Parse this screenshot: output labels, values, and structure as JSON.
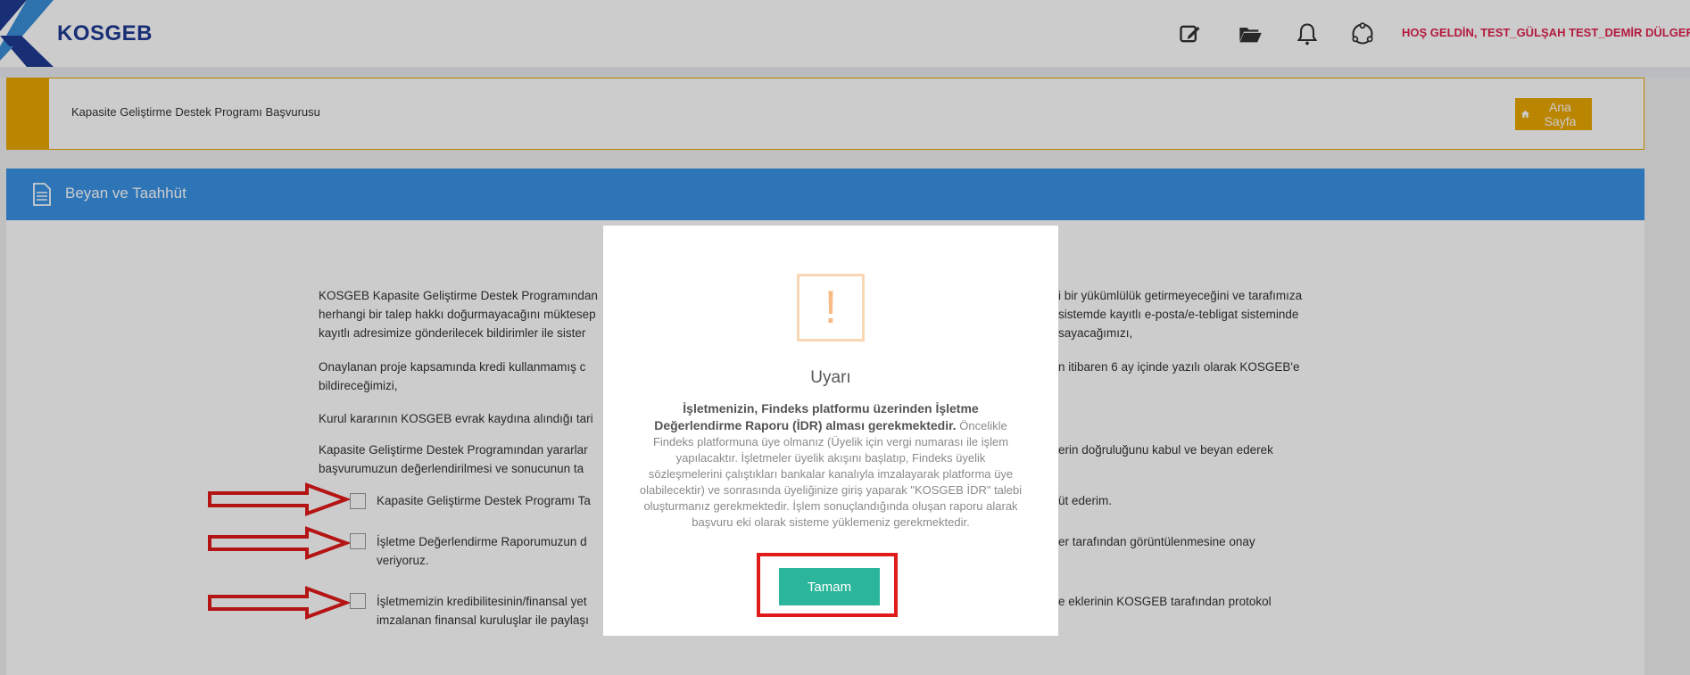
{
  "header": {
    "logo_text": "KOSGEB",
    "icons": [
      "edit-icon",
      "folder-icon",
      "bell-icon",
      "user-icon"
    ],
    "welcome": "HOŞ GELDİN, TEST_GÜLŞAH  TEST_DEMİR DÜLGER"
  },
  "breadcrumb": {
    "title": "Kapasite Geliştirme Destek Programı Başvurusu",
    "home_button": "Ana Sayfa"
  },
  "panel": {
    "title": "Beyan ve Taahhüt"
  },
  "paragraphs": [
    {
      "left_lines": [
        "KOSGEB Kapasite Geliştirme Destek Programından",
        "herhangi bir talep hakkı doğurmayacağını müktesep",
        "kayıtlı adresimize gönderilecek bildirimler ile sister"
      ],
      "right_lines": [
        "i bir yükümlülük getirmeyeceğini ve tarafımıza",
        "sistemde kayıtlı e-posta/e-tebligat sisteminde",
        "sayacağımızı,"
      ]
    },
    {
      "left_lines": [
        "Onaylanan proje kapsamında kredi kullanmamış c",
        "bildireceğimizi,"
      ],
      "right_lines": [
        "n itibaren 6 ay içinde yazılı olarak KOSGEB'e"
      ]
    },
    {
      "left_lines": [
        "Kurul kararının KOSGEB evrak kaydına alındığı tari"
      ],
      "right_lines": []
    },
    {
      "left_lines": [
        "Kapasite Geliştirme Destek Programından yararlar",
        "başvurumuzun değerlendirilmesi ve sonucunun ta"
      ],
      "right_lines": [
        "erin doğruluğunu kabul ve beyan ederek"
      ]
    }
  ],
  "checkboxes": [
    {
      "left_lines": [
        "Kapasite Geliştirme Destek Programı Ta"
      ],
      "right_lines": [
        "üt ederim."
      ]
    },
    {
      "left_lines": [
        "İşletme Değerlendirme Raporumuzun d",
        "veriyoruz."
      ],
      "right_lines": [
        "er tarafından görüntülenmesine onay"
      ]
    },
    {
      "left_lines": [
        "İşletmemizin kredibilitesinin/finansal yet",
        "imzalanan finansal kuruluşlar ile paylaşı"
      ],
      "right_lines": [
        "e eklerinin KOSGEB tarafından protokol"
      ]
    }
  ],
  "modal": {
    "icon": "warning-icon",
    "icon_glyph": "!",
    "title": "Uyarı",
    "message_bold": "İşletmenizin, Findeks platformu üzerinden İşletme Değerlendirme Raporu (İDR) alması gerekmektedir.",
    "message_rest": " Öncelikle Findeks platformuna üye olmanız (Üyelik için vergi numarası ile işlem yapılacaktır. İşletmeler üyelik akışını başlatıp, Findeks üyelik sözleşmelerini çalıştıkları bankalar kanalıyla imzalayarak platforma üye olabilecektir) ve sonrasında üyeliğinize giriş yaparak \"KOSGEB İDR\" talebi oluşturmanız gerekmektedir. İşlem sonuçlandığında oluşan raporu alarak başvuru eki olarak sisteme yüklemeniz gerekmektedir.",
    "ok_button": "Tamam"
  },
  "colors": {
    "accent_blue": "#3a93e6",
    "accent_orange": "#e9a700",
    "ok_green": "#2bb59a",
    "highlight_red": "#e11a1a",
    "welcome_red": "#e0224f"
  }
}
